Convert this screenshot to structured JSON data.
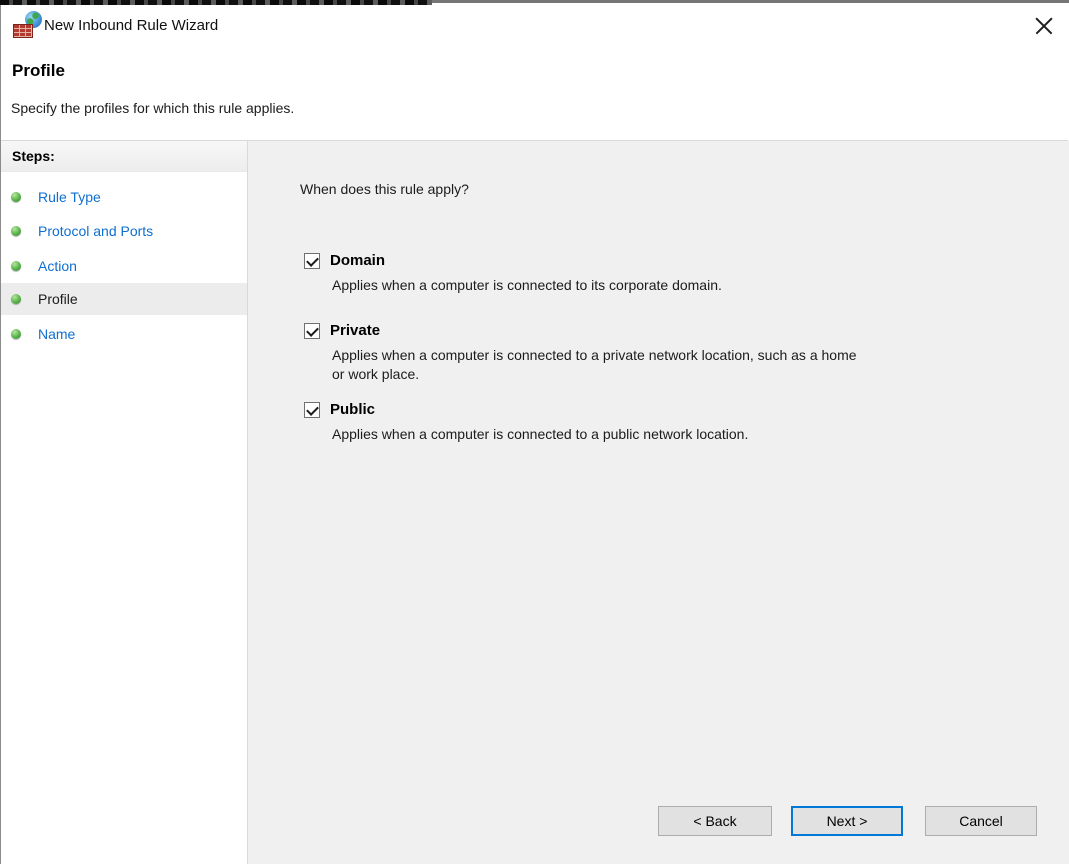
{
  "window": {
    "title": "New Inbound Rule Wizard",
    "icons": {
      "app_icon": "firewall-brick-wall-with-globe",
      "close": "x",
      "step_bullet": "green-orb",
      "checkbox_check": "check-mark"
    }
  },
  "header": {
    "title": "Profile",
    "subtitle": "Specify the profiles for which this rule applies."
  },
  "sidebar": {
    "heading": "Steps:",
    "items": [
      {
        "label": "Rule Type",
        "state": "link"
      },
      {
        "label": "Protocol and Ports",
        "state": "link"
      },
      {
        "label": "Action",
        "state": "link"
      },
      {
        "label": "Profile",
        "state": "current"
      },
      {
        "label": "Name",
        "state": "link"
      }
    ]
  },
  "main": {
    "question": "When does this rule apply?",
    "options": [
      {
        "label": "Domain",
        "checked": true,
        "description": "Applies when a computer is connected to its corporate domain."
      },
      {
        "label": "Private",
        "checked": true,
        "description": "Applies when a computer is connected to a private network location, such as a home\nor work place."
      },
      {
        "label": "Public",
        "checked": true,
        "description": "Applies when a computer is connected to a public network location."
      }
    ]
  },
  "buttons": {
    "back": "< Back",
    "next": "Next >",
    "cancel": "Cancel"
  },
  "colors": {
    "link_blue": "#0f6fd0",
    "focus_blue": "#0078d7",
    "step_green": "#43a336",
    "content_bg": "#f0f0f0",
    "sidebar_bg": "#ffffff",
    "active_step_bg": "#ececec",
    "button_bg": "#e1e1e1",
    "button_border": "#adadad"
  }
}
